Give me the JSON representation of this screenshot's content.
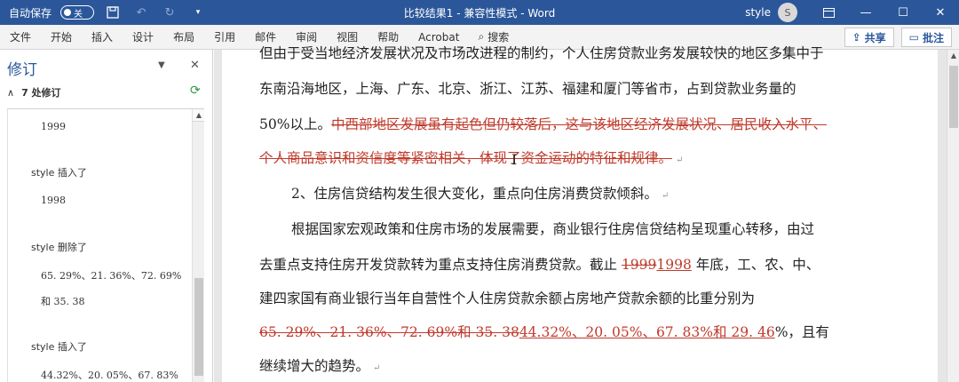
{
  "titlebar": {
    "autosave_label": "自动保存",
    "autosave_state": "关",
    "title": "比较结果1  -  兼容性模式  -  Word",
    "user_name": "style",
    "user_initial": "S"
  },
  "ribbon": {
    "tabs": [
      "文件",
      "开始",
      "插入",
      "设计",
      "布局",
      "引用",
      "邮件",
      "审阅",
      "视图",
      "帮助",
      "Acrobat"
    ],
    "search_label": "搜索",
    "share_label": "共享",
    "comment_label": "批注"
  },
  "pane": {
    "title": "修订",
    "count_label": "7 处修订",
    "items": [
      {
        "text": "1999"
      },
      {
        "head": "style  插入了",
        "text": "1998"
      },
      {
        "head": "style  删除了",
        "text": "65. 29%、21. 36%、72. 69%",
        "text2": "和 35. 38"
      },
      {
        "head": "style  插入了",
        "text": "44.32%、20. 05%、67. 83%"
      }
    ]
  },
  "document": {
    "line1": "但由于受当地经济发展状况及市场改进程的制约，个人住房贷款业务发展较快的地区多集中于",
    "line2": "东南沿海地区，上海、广东、北京、浙江、江苏、福建和厦门等省市，占到贷款业务量的",
    "line3_normal": "50%以上。",
    "line3_del": "中西部地区发展虽有起色但仍较落后，这与该地区经济发展状况、居民收入水平、",
    "line4_del": "个人商品意识和资信度等紧密相关，体现了资金运动的特征和规律。",
    "line5": "2、住房信贷结构发生很大变化，重点向住房消费贷款倾斜。",
    "line6": "根据国家宏观政策和住房市场的发展需要，商业银行住房信贷结构呈现重心转移，由过",
    "line7_a": "去重点支持住房开发贷款转为重点支持住房消费贷款。截止 ",
    "line7_del": "1999",
    "line7_ins": "1998",
    "line7_b": " 年底，工、农、中、",
    "line8": "建四家国有商业银行当年自营性个人住房贷款余额占房地产贷款余额的比重分别为",
    "line9_del": "65. 29%、21. 36%、72. 69%和 35. 38",
    "line9_ins": "44.32%、20. 05%、67. 83%和 29. 46",
    "line9_b": "%，且有",
    "line10": "继续增大的趋势。",
    "cursor": "I"
  },
  "colors": {
    "titlebar_bg": "#2b579a",
    "revision": "#c0392b"
  }
}
